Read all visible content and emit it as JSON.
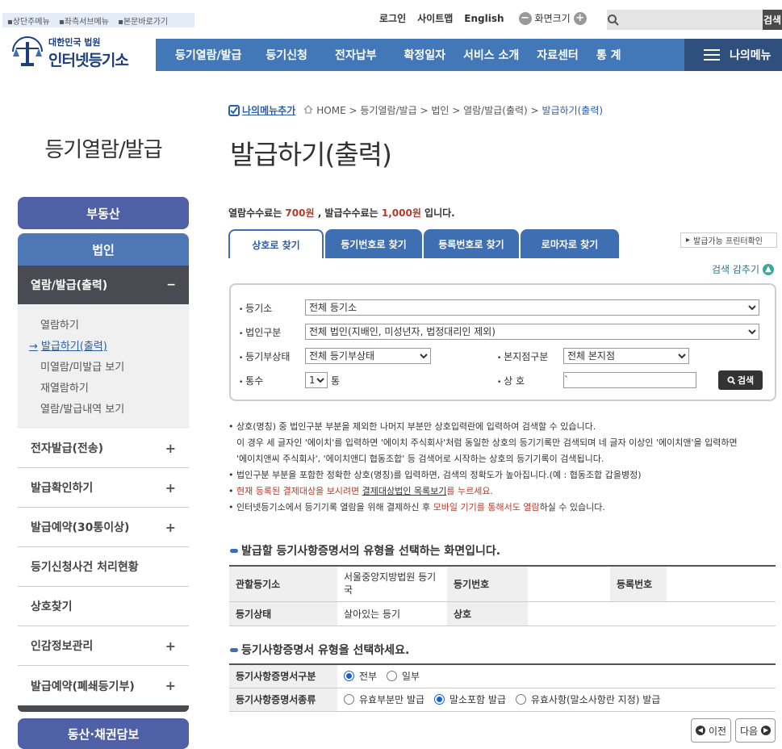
{
  "skip_links": [
    "상단주메뉴",
    "좌측서브메뉴",
    "본문바로가기"
  ],
  "util": {
    "login": "로그인",
    "sitemap": "사이트맵",
    "english": "English",
    "zoom_label": "화면크기",
    "search_button": "검색"
  },
  "logo": {
    "line1": "대한민국 법원",
    "line2": "인터넷등기소"
  },
  "gnb": [
    "등기열람/발급",
    "등기신청",
    "전자납부",
    "확정일자",
    "서비스 소개",
    "자료센터",
    "통 계"
  ],
  "my_menu": "나의메뉴",
  "lnb": {
    "title": "등기열람/발급",
    "real_estate": "부동산",
    "corporation": "법인",
    "active_section": "열람/발급(출력)",
    "active_toggle": "−",
    "sub_items": [
      "열람하기",
      "발급하기(출력)",
      "미열람/미발급 보기",
      "재열람하기",
      "열람/발급내역 보기"
    ],
    "current_marker": "→",
    "items": [
      {
        "label": "전자발급(전송)",
        "toggle": "+"
      },
      {
        "label": "발급확인하기",
        "toggle": "+"
      },
      {
        "label": "발급예약(30통이상)",
        "toggle": "+"
      },
      {
        "label": "등기신청사건 처리현황",
        "toggle": ""
      },
      {
        "label": "상호찾기",
        "toggle": ""
      },
      {
        "label": "인감정보관리",
        "toggle": "+"
      },
      {
        "label": "발급예약(폐쇄등기부)",
        "toggle": "+"
      }
    ],
    "movable": "동산·채권담보"
  },
  "breadcrumb": {
    "add_my_menu": "나의메뉴추가",
    "home": "HOME",
    "path": "> 등기열람/발급 > 법인 > 열람/발급(출력) >",
    "current": "발급하기(출력)"
  },
  "page_title": "발급하기(출력)",
  "fee": {
    "pre": "열람수수료는 ",
    "view_fee": "700원",
    "mid": " , 발급수수료는 ",
    "issue_fee": "1,000원",
    "post": " 입니다."
  },
  "tabs": [
    "상호로 찾기",
    "등기번호로 찾기",
    "등록번호로 찾기",
    "로마자로 찾기"
  ],
  "print_check": "발급가능 프린터확인",
  "hide_search": "검색 감추기",
  "form": {
    "registry_label": "등기소",
    "registry_value": "전체 등기소",
    "corp_type_label": "법인구분",
    "corp_type_value": "전체 법인(지배인, 미성년자, 법정대리인 제외)",
    "status_label": "등기부상태",
    "status_value": "전체 등기부상태",
    "branch_label": "본지점구분",
    "branch_value": "전체 본지점",
    "count_label": "통수",
    "count_value": "1",
    "count_unit": "통",
    "name_label": "상 호",
    "name_value": "`",
    "search_button": "검색"
  },
  "notes": {
    "n1": "상호(명칭) 중 법인구분 부분을 제외한 나머지 부분만 상호입력란에 입력하여 검색할 수 있습니다.",
    "n1b": "이 경우 세 글자인 '에이치'를 입력하면 '에이치 주식회사'처럼 동일한 상호의 등기기록만 검색되며 네 글자 이상인 '에이치앤'을 입력하면",
    "n1c": "'에이치앤씨 주식회사', '에이치앤디 협동조합' 등 검색어로 시작하는 상호의 등기기록이 검색됩니다.",
    "n2": "법인구분 부분을 포함한 정확한 상호(명칭)를 입력하면, 검색의 정확도가 높아집니다.(예 : 협동조합 갑을병정)",
    "n3_red": "현재 등록된 결제대상을 보시려면 ",
    "n3_link": "결제대상법인 목록보기",
    "n3_post": "를 누르세요.",
    "n4_pre": "인터넷등기소에서 등기기록 열람을 위해 결제하신 후 ",
    "n4_red": "모바일 기기를 통해서도 열람",
    "n4_post": "하실 수 있습니다."
  },
  "section1": "발급할 등기사항증명서의 유형을 선택하는 화면입니다.",
  "info_table": {
    "office_label": "관할등기소",
    "office_value": "서울중앙지방법원 등기국",
    "regno_label": "등기번호",
    "regno_value": "",
    "recno_label": "등록번호",
    "recno_value": "",
    "status_label": "등기상태",
    "status_value": "살아있는 등기",
    "name_label": "상호",
    "name_value": ""
  },
  "section2": "등기사항증명서 유형을 선택하세요.",
  "type_table": {
    "kind_label": "등기사항증명서구분",
    "kind_options": [
      "전부",
      "일부"
    ],
    "kind_selected": 0,
    "class_label": "등기사항증명서종류",
    "class_options": [
      "유효부분만 발급",
      "말소포함 발급",
      "유효사항(말소사항란 지정) 발급"
    ],
    "class_selected": 1
  },
  "nav": {
    "prev": "이전",
    "next": "다음"
  },
  "colors": {
    "gnb": "#4278b7",
    "my_menu": "#2f4f7c",
    "accent_red": "#b23b2b",
    "pill_blue": "#5060a6"
  }
}
